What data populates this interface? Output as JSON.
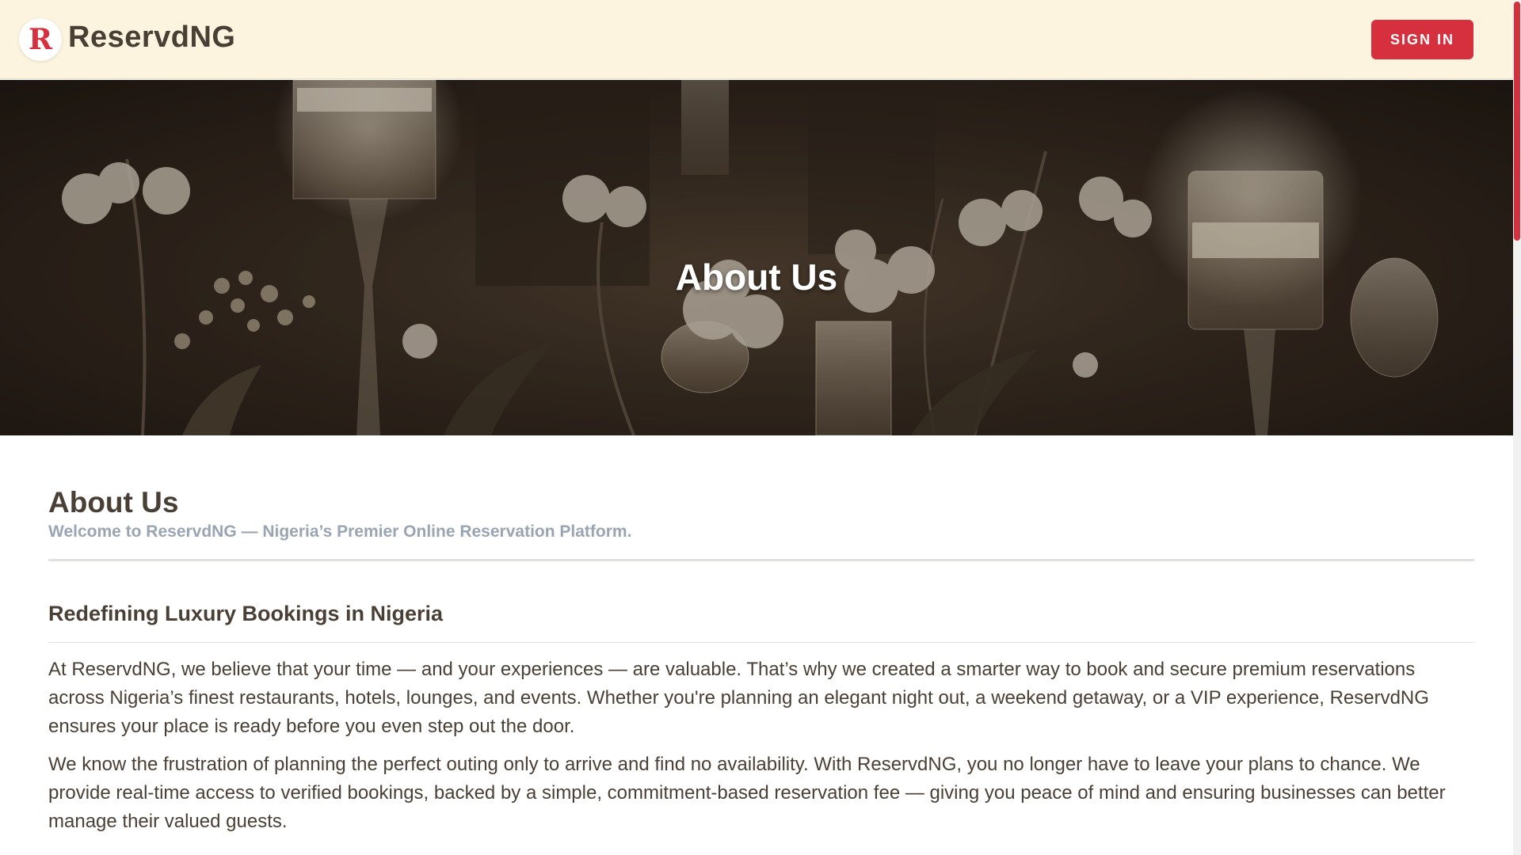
{
  "header": {
    "logo_letter": "R",
    "brand": "ReservdNG",
    "signin_label": "SIGN IN"
  },
  "hero": {
    "title": "About Us"
  },
  "main": {
    "title": "About Us",
    "subtitle": "Welcome to ReservdNG — Nigeria’s Premier Online Reservation Platform.",
    "section_title": "Redefining Luxury Bookings in Nigeria",
    "paragraphs": [
      "At ReservdNG, we believe that your time — and your experiences — are valuable. That’s why we created a smarter way to book and secure premium reservations across Nigeria’s finest restaurants, hotels, lounges, and events. Whether you're planning an elegant night out, a weekend getaway, or a VIP experience, ReservdNG ensures your place is ready before you even step out the door.",
      "We know the frustration of planning the perfect outing only to arrive and find no availability. With ReservdNG, you no longer have to leave your plans to chance. We provide real-time access to verified bookings, backed by a simple, commitment-based reservation fee — giving you peace of mind and ensuring businesses can better manage their valued guests."
    ]
  },
  "colors": {
    "accent": "#d6303f",
    "header_bg": "#fdf4df",
    "text": "#4a3f35",
    "muted": "#9aa5b4"
  }
}
